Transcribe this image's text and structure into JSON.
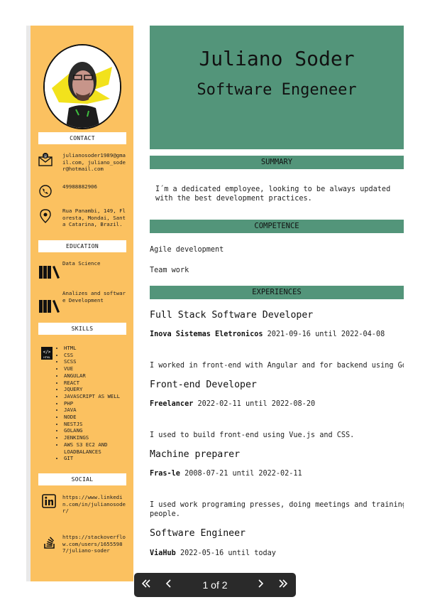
{
  "resume": {
    "name": "Juliano Soder",
    "role": "Software Engeneer",
    "sidebar": {
      "contact_heading": "CONTACT",
      "email": "julianosoder1989@gmail.com, juliano_soder@hotmail.com",
      "phone": "49988882906",
      "address": "Rua Panambi, 149, Floresta, Mondai, Santa Catarina, Brazil.",
      "education_heading": "EDUCATION",
      "education": [
        "Data Science",
        "Analizes and software Development"
      ],
      "skills_heading": "SKILLS",
      "skills": [
        "HTML",
        "CSS",
        "SCSS",
        "VUE",
        "ANGULAR",
        "REACT",
        "JQUERY",
        "JAVASCRIPT AS WELL",
        "PHP",
        "JAVA",
        "NODE",
        "NESTJS",
        "GOLANG",
        "JENKINGS",
        "AWS S3 EC2 AND LOADBALANCES",
        "GIT"
      ],
      "social_heading": "SOCIAL",
      "linkedin": "https://www.linkedin.com/in/julianosoder/",
      "stackoverflow": "https://stackoverflow.com/users/16555987/juliano-soder"
    },
    "summary_heading": "SUMMARY",
    "summary_line1": "I´m a dedicated employee, looking to be always updated",
    "summary_line2": "with the best development practices.",
    "competence_heading": "COMPETENCE",
    "competences": [
      "Agile development",
      "Team work"
    ],
    "experiences_heading": "EXPERIENCES",
    "experiences": [
      {
        "title": "Full Stack Software Developer",
        "company": "Inova Sistemas Eletronicos",
        "dates": "2021-09-16 until 2022-04-08",
        "desc": "I worked in front-end with Angular and for backend using Go"
      },
      {
        "title": "Front-end Developer",
        "company": "Freelancer",
        "dates": "2022-02-11 until 2022-08-20",
        "desc": "I used to build front-end using Vue.js and CSS."
      },
      {
        "title": "Machine preparer",
        "company": "Fras-le",
        "dates": "2008-07-21 until 2022-02-11",
        "desc": "I used work programing presses, doing meetings and training",
        "desc2": "people."
      },
      {
        "title": "Software Engineer",
        "company": "ViaHub",
        "dates": "2022-05-16 until today"
      }
    ]
  },
  "pager": {
    "page_info": "1 of 2",
    "first_icon": "double-chevron-left",
    "prev_icon": "chevron-left",
    "next_icon": "chevron-right",
    "last_icon": "double-chevron-right"
  }
}
